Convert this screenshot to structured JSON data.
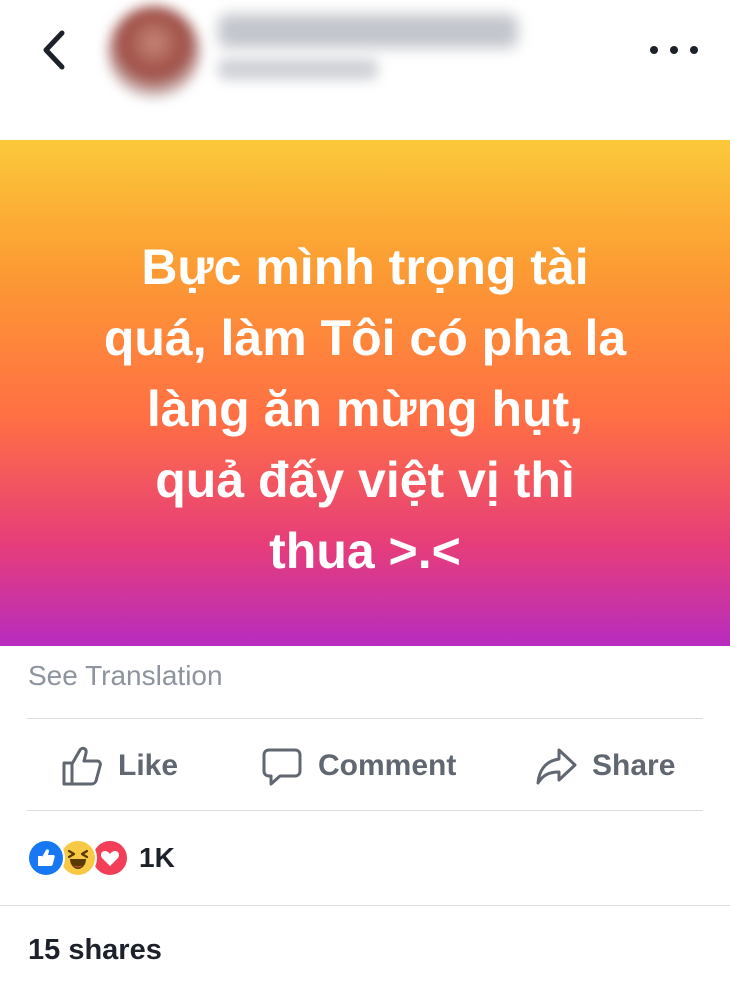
{
  "header": {
    "author_name": "",
    "icons": {
      "back": "chevron-left-icon",
      "more": "more-horizontal-icon"
    }
  },
  "post": {
    "text_lines": [
      "Bực mình trọng tài",
      "quá, làm Tôi có pha la",
      "làng ăn mừng hụt,",
      "quả đấy việt vị thì",
      "thua >.<"
    ],
    "background_gradient": [
      "#fbc93a",
      "#fc9c33",
      "#ff6f44",
      "#e63d7a",
      "#b72cbf"
    ],
    "text_color": "#ffffff"
  },
  "translation": {
    "label": "See Translation"
  },
  "actions": {
    "like_label": "Like",
    "comment_label": "Comment",
    "share_label": "Share",
    "color": "#606770"
  },
  "reactions": {
    "types": [
      "like",
      "haha",
      "love"
    ],
    "count": "1K"
  },
  "shares": {
    "label": "15 shares"
  }
}
